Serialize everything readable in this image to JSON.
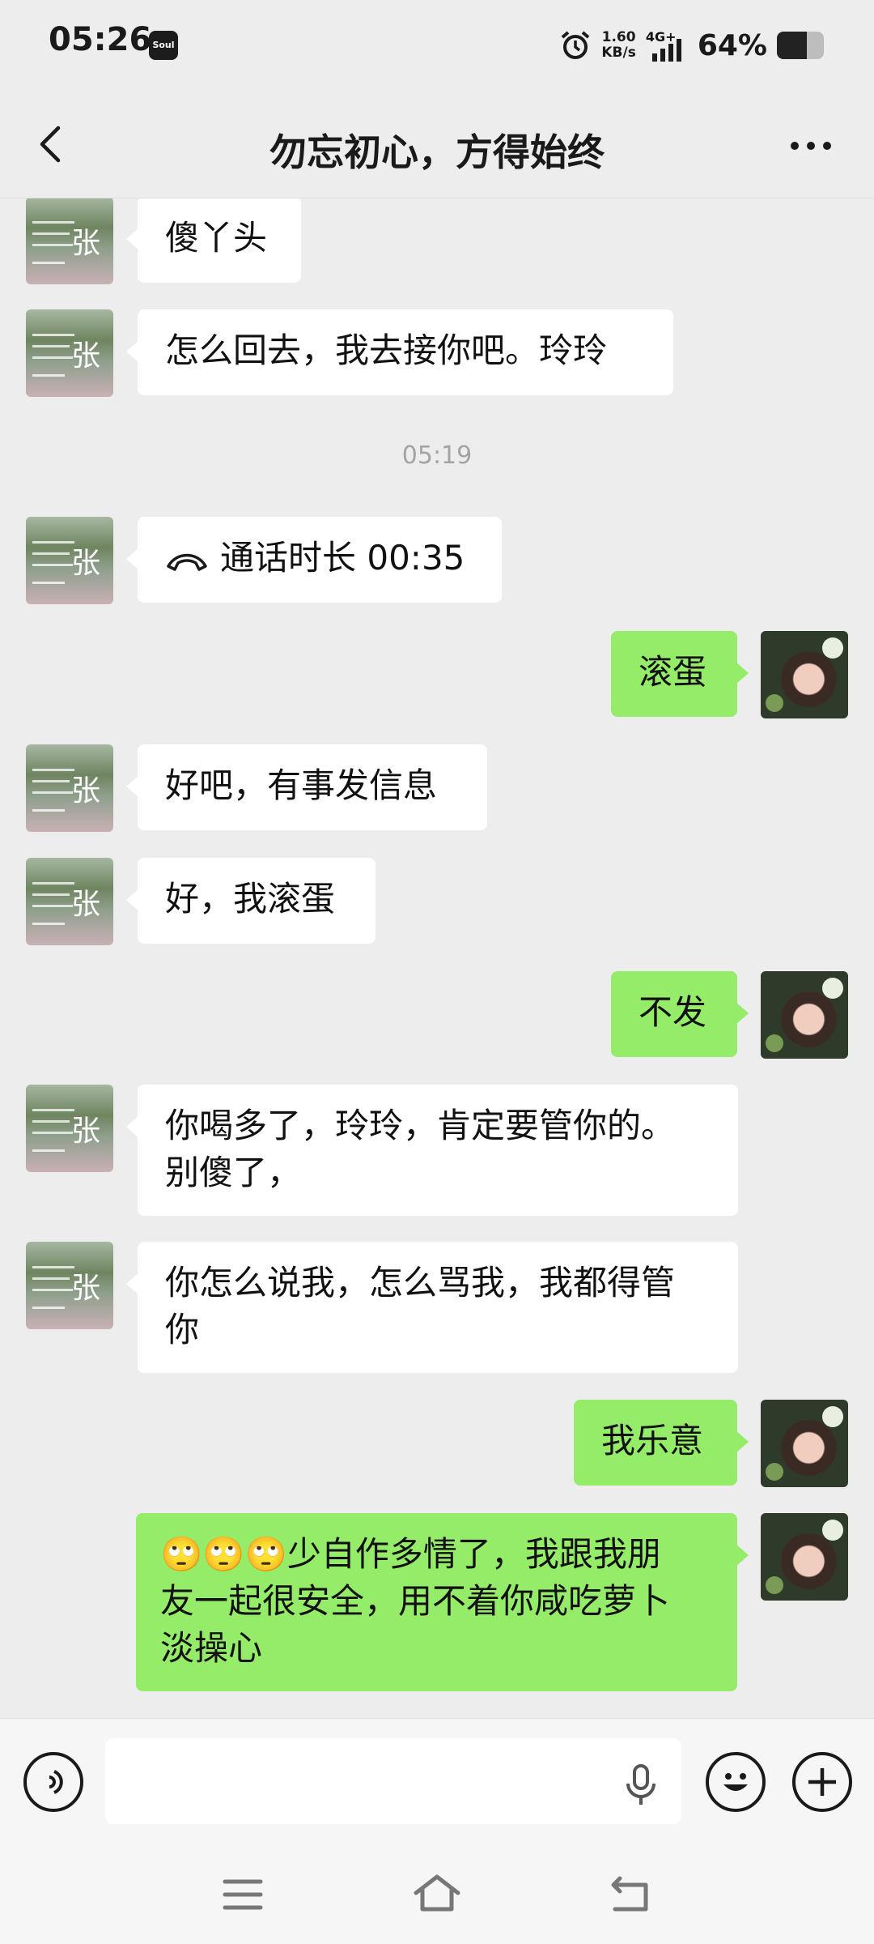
{
  "status_bar": {
    "time": "05:26",
    "app_icon_label": "Soul",
    "net_speed_value": "1.60",
    "net_speed_unit": "KB/s",
    "network": "4G+",
    "battery_pct": "64%",
    "battery_level": 0.64,
    "icons": [
      "alarm-icon",
      "signal-icon",
      "battery-icon"
    ]
  },
  "header": {
    "title": "勿忘初心，方得始终",
    "back_icon": "chevron-left-icon",
    "more_icon": "more-dots-icon"
  },
  "messages": [
    {
      "side": "in",
      "text": "傻丫头"
    },
    {
      "side": "in",
      "text": "怎么回去，我去接你吧。玲玲"
    },
    {
      "type": "time",
      "text": "05:19"
    },
    {
      "side": "in",
      "type": "call",
      "text": "通话时长 00:35"
    },
    {
      "side": "out",
      "text": "滚蛋"
    },
    {
      "side": "in",
      "text": "好吧，有事发信息"
    },
    {
      "side": "in",
      "text": "好，我滚蛋"
    },
    {
      "side": "out",
      "text": "不发"
    },
    {
      "side": "in",
      "line1": "你喝多了，玲玲，肯定要管你的。",
      "line2": "别傻了，"
    },
    {
      "side": "in",
      "line1": "你怎么说我，怎么骂我，我都得管",
      "line2": "你"
    },
    {
      "side": "out",
      "text": "我乐意"
    },
    {
      "side": "out",
      "emoji": "🙄🙄🙄",
      "line1": "少自作多情了，我跟我朋",
      "line2": "友一起很安全，用不着你咸吃萝卜",
      "line3": "淡操心"
    }
  ],
  "avatars": {
    "other_char": "张"
  },
  "input_bar": {
    "voice_icon": "voice-mode-icon",
    "placeholder": "",
    "mic_icon": "microphone-icon",
    "emoji_icon": "emoji-icon",
    "add_icon": "plus-icon"
  },
  "system_nav": {
    "menu_icon": "menu-icon",
    "home_icon": "home-icon",
    "back_icon": "back-arrow-icon"
  },
  "colors": {
    "background": "#ededed",
    "bubble_out": "#95ec69",
    "bubble_in": "#ffffff"
  }
}
